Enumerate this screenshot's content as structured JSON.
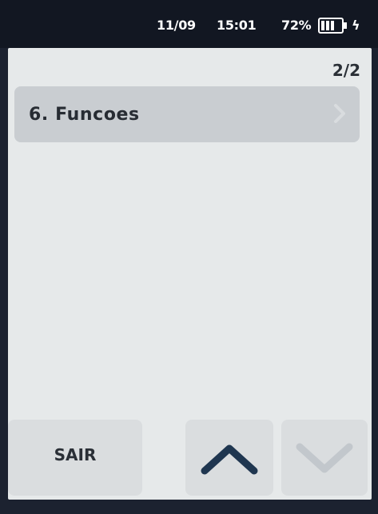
{
  "status": {
    "date": "11/09",
    "time": "15:01",
    "battery": "72%",
    "battery_icon": "battery-icon",
    "charging_icon": "lightning-icon"
  },
  "screen": {
    "page_indicator": "2/2",
    "menu_items": [
      {
        "label": "6. Funcoes",
        "icon": "chevron-right-icon"
      }
    ]
  },
  "buttons": {
    "exit_label": "SAIR",
    "up_icon": "chevron-up-icon",
    "down_icon": "chevron-down-icon"
  },
  "colors": {
    "screen_bg": "#e6e9ea",
    "item_bg": "#c9cdd1",
    "text": "#272c33"
  }
}
